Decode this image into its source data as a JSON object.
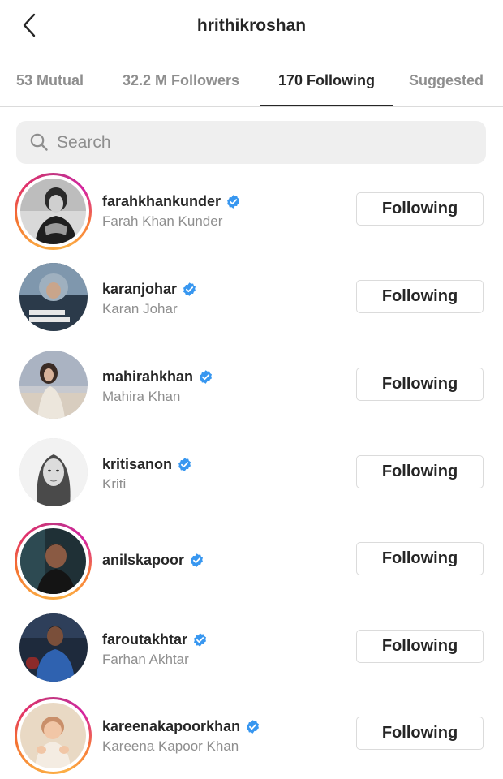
{
  "header": {
    "title": "hrithikroshan"
  },
  "tabs": [
    {
      "label": "53 Mutual"
    },
    {
      "label": "32.2 M Followers"
    },
    {
      "label": "170 Following"
    },
    {
      "label": "Suggested"
    }
  ],
  "search": {
    "placeholder": "Search"
  },
  "users": [
    {
      "username": "farahkhankunder",
      "full_name": "Farah Khan Kunder",
      "button": "Following",
      "verified": true,
      "has_story": true
    },
    {
      "username": "karanjohar",
      "full_name": "Karan Johar",
      "button": "Following",
      "verified": true,
      "has_story": false
    },
    {
      "username": "mahirahkhan",
      "full_name": "Mahira Khan",
      "button": "Following",
      "verified": true,
      "has_story": false
    },
    {
      "username": "kritisanon",
      "full_name": "Kriti",
      "button": "Following",
      "verified": true,
      "has_story": false
    },
    {
      "username": "anilskapoor",
      "full_name": "",
      "button": "Following",
      "verified": true,
      "has_story": true
    },
    {
      "username": "faroutakhtar",
      "full_name": "Farhan Akhtar",
      "button": "Following",
      "verified": true,
      "has_story": false
    },
    {
      "username": "kareenakapoorkhan",
      "full_name": "Kareena Kapoor Khan",
      "button": "Following",
      "verified": true,
      "has_story": true
    }
  ],
  "colors": {
    "verified_blue": "#3897f0",
    "text_primary": "#262626",
    "text_secondary": "#8e8e8e",
    "border": "#dbdbdb",
    "search_bg": "#efefef"
  },
  "icons": {
    "back": "chevron-left-icon",
    "search": "search-icon",
    "verified": "verified-badge-icon"
  }
}
